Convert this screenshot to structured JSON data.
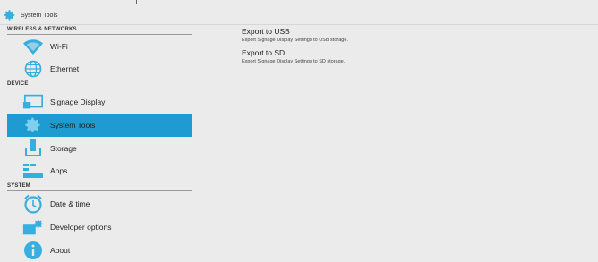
{
  "window": {
    "title": "System Tools"
  },
  "sidebar": {
    "sections": [
      {
        "label": "WIRELESS & NETWORKS"
      },
      {
        "label": "DEVICE"
      },
      {
        "label": "SYSTEM"
      }
    ],
    "items": [
      {
        "label": "Wi-Fi",
        "icon": "wifi-icon"
      },
      {
        "label": "Ethernet",
        "icon": "globe-icon"
      },
      {
        "label": "Signage Display",
        "icon": "display-icon"
      },
      {
        "label": "System Tools",
        "icon": "gear-icon",
        "active": true
      },
      {
        "label": "Storage",
        "icon": "storage-icon"
      },
      {
        "label": "Apps",
        "icon": "apps-icon"
      },
      {
        "label": "Date & time",
        "icon": "clock-icon"
      },
      {
        "label": "Developer options",
        "icon": "developer-icon"
      },
      {
        "label": "About",
        "icon": "info-icon"
      }
    ]
  },
  "main": {
    "actions": [
      {
        "title": "Export to USB",
        "description": "Export Signage Display Settings to USB storage."
      },
      {
        "title": "Export to SD",
        "description": "Export Signage Display Settings to SD storage."
      }
    ]
  },
  "colors": {
    "accent": "#1e9bd0",
    "background": "#ebebeb",
    "icon": "#35aee0"
  }
}
